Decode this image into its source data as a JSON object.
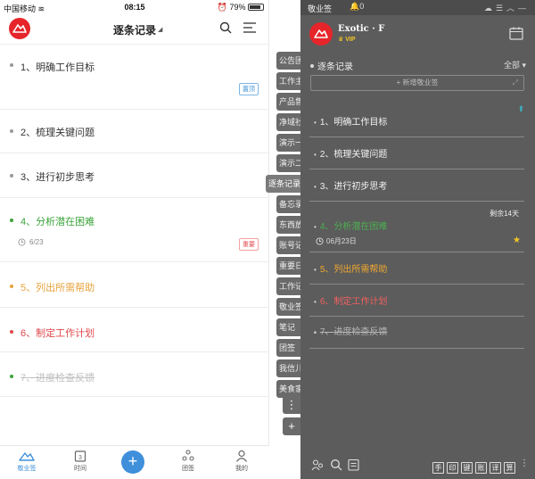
{
  "status": {
    "carrier": "中国移动",
    "time": "08:15",
    "battery": "79%"
  },
  "mobile": {
    "title": "逐条记录",
    "items": [
      {
        "text": "1、明确工作目标",
        "color": "#333333",
        "tag": "置顶"
      },
      {
        "text": "2、梳理关键问题",
        "color": "#333333"
      },
      {
        "text": "3、进行初步思考",
        "color": "#333333"
      },
      {
        "text": "4、分析潜在困难",
        "color": "#3aa33a",
        "date": "6/23",
        "tag": "重要"
      },
      {
        "text": "5、列出所需帮助",
        "color": "#e6a23c"
      },
      {
        "text": "6、制定工作计划",
        "color": "#e0474b"
      },
      {
        "text": "7、进度检查反馈",
        "color": "#c0c0c0",
        "done": true
      }
    ],
    "tabs": [
      "敬业签",
      "时间",
      "团签",
      "我的"
    ],
    "fab": "+",
    "calendar_day": "3"
  },
  "side_tabs": [
    "公告团",
    "工作主",
    "产品售",
    "净域社",
    "演示一",
    "演示二",
    "逐条记录",
    "备忘录",
    "东西放",
    "账号记",
    "重要日",
    "工作记",
    "敬业签",
    "笔记",
    "团签",
    "我信儿",
    "美食家"
  ],
  "side_active": "逐条记录",
  "side_buttons": [
    "⋮",
    "+"
  ],
  "widget": {
    "app": "敬业签",
    "notify": "0",
    "user": "Exotic · F",
    "vip": "VIP",
    "section": "逐条记录",
    "filter": "全部",
    "new_placeholder": "+ 新增敬业签",
    "remaining": "剩余14天",
    "items": [
      {
        "text": "1、明确工作目标",
        "color": "#f2f2f2"
      },
      {
        "text": "2、梳理关键问题",
        "color": "#f2f2f2"
      },
      {
        "text": "3、进行初步思考",
        "color": "#f2f2f2"
      },
      {
        "text": "4、分析潜在困难",
        "color": "#4caf50",
        "date": "06月23日"
      },
      {
        "text": "5、列出所需帮助",
        "color": "#f0a830"
      },
      {
        "text": "6、制定工作计划",
        "color": "#f06060"
      },
      {
        "text": "7、进度检查反馈",
        "color": "#b5b5b5",
        "done": true
      }
    ],
    "keys": [
      "手",
      "印",
      "键",
      "账",
      "译",
      "算"
    ]
  },
  "colors": {
    "brand_red": "#e6252b",
    "accent_blue": "#3f8fdb"
  }
}
